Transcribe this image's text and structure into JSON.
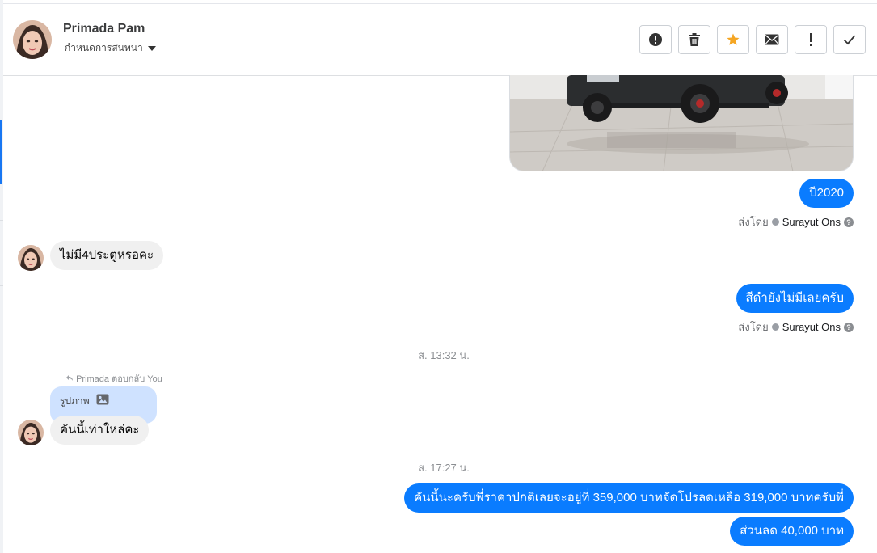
{
  "header": {
    "contact_name": "Primada Pam",
    "conversation_setting": "กำหนดการสนทนา",
    "actions": [
      {
        "name": "alert-circle-icon",
        "label": "Report"
      },
      {
        "name": "trash-icon",
        "label": "Delete"
      },
      {
        "name": "star-icon",
        "label": "Star"
      },
      {
        "name": "mail-icon",
        "label": "Mark unread"
      },
      {
        "name": "exclamation-icon",
        "label": "Important"
      },
      {
        "name": "check-icon",
        "label": "Done"
      }
    ]
  },
  "colors": {
    "outgoing_bubble": "#0a7cff",
    "incoming_bubble": "#f0f0f0",
    "star": "#f5a623",
    "rail_marker": "#1877f2"
  },
  "messages": {
    "out_year": "ปี2020",
    "sent_by_label": "ส่งโดย",
    "sender_name": "Surayut Ons",
    "in_4door": "ไม่มี4ประตูหรอคะ",
    "out_color": "สีดำยังไม่มีเลยครับ",
    "time_1": "ส. 13:32 น.",
    "reply_note": "Primada ตอบกลับ You",
    "quoted_label": "รูปภาพ",
    "in_only_car": "คันนี้เท่าใหล่คะ",
    "time_2": "ส. 17:27 น.",
    "out_price": "คันนี้นะครับพี่ราคาปกติเลยจะอยู่ที่ 359,000 บาทจัดโปรลดเหลือ 319,000 บาทครับพี่",
    "out_discount": "ส่วนลด 40,000 บาท"
  }
}
